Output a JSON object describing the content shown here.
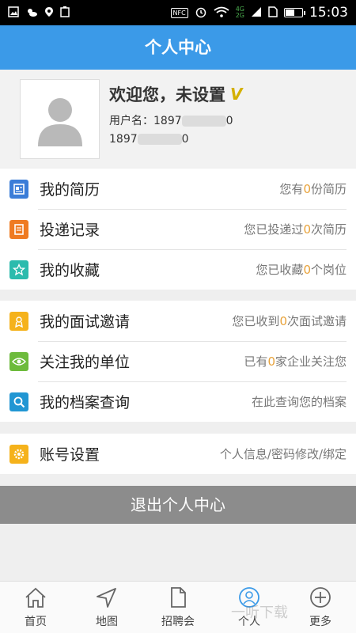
{
  "status_bar": {
    "time": "15:03",
    "nfc": "NFC",
    "net_top": "4G",
    "net_bottom": "2G",
    "battery_level": 0.55
  },
  "title": "个人中心",
  "profile": {
    "welcome": "欢迎您，未设置",
    "vip_mark": "V",
    "username_label": "用户名：",
    "username_visible": "1897",
    "username_tail": "0",
    "phone_visible": "1897",
    "phone_tail": "0"
  },
  "groups": [
    {
      "items": [
        {
          "label": "我的简历",
          "desc_pre": "您有",
          "num": "0",
          "desc_post": "份简历",
          "icon": "resume-icon",
          "color": "#3b7dd8"
        },
        {
          "label": "投递记录",
          "desc_pre": "您已投递过",
          "num": "0",
          "desc_post": "次简历",
          "icon": "delivery-icon",
          "color": "#ef7b22"
        },
        {
          "label": "我的收藏",
          "desc_pre": "您已收藏",
          "num": "0",
          "desc_post": "个岗位",
          "icon": "star-icon",
          "color": "#2bbbad"
        }
      ]
    },
    {
      "items": [
        {
          "label": "我的面试邀请",
          "desc_pre": "您已收到",
          "num": "0",
          "desc_post": "次面试邀请",
          "icon": "invitation-icon",
          "color": "#f5b21b"
        },
        {
          "label": "关注我的单位",
          "desc_pre": "已有",
          "num": "0",
          "desc_post": "家企业关注您",
          "icon": "eye-icon",
          "color": "#6dbb3c"
        },
        {
          "label": "我的档案查询",
          "desc_pre": "在此查询您的档案",
          "num": "",
          "desc_post": "",
          "icon": "search-icon",
          "color": "#2196d3"
        }
      ]
    },
    {
      "items": [
        {
          "label": "账号设置",
          "desc_pre": "个人信息/密码修改/绑定",
          "num": "",
          "desc_post": "",
          "icon": "gear-icon",
          "color": "#f5b21b"
        }
      ]
    }
  ],
  "logout_label": "退出个人中心",
  "tabs": [
    {
      "label": "首页",
      "icon": "home-icon"
    },
    {
      "label": "地图",
      "icon": "map-icon"
    },
    {
      "label": "招聘会",
      "icon": "document-icon"
    },
    {
      "label": "个人",
      "icon": "person-icon"
    },
    {
      "label": "更多",
      "icon": "plus-icon"
    }
  ],
  "watermark": "一听下载"
}
